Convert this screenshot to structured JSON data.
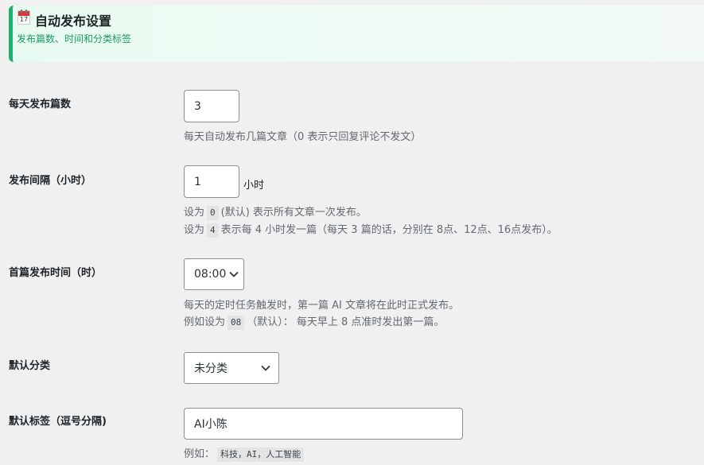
{
  "header": {
    "icon": "calendar-icon",
    "calendar_day": "17",
    "title": "自动发布设置",
    "subtitle": "发布篇数、时间和分类标签"
  },
  "fields": {
    "posts_per_day": {
      "label": "每天发布篇数",
      "value": "3",
      "description": "每天自动发布几篇文章（0 表示只回复评论不发文）"
    },
    "interval": {
      "label": "发布间隔（小时）",
      "value": "1",
      "unit": "小时",
      "desc1_pre": "设为",
      "desc1_code": "0",
      "desc1_post": "(默认) 表示所有文章一次发布。",
      "desc2_pre": "设为",
      "desc2_code": "4",
      "desc2_post": "表示每 4 小时发一篇（每天 3 篇的话，分别在 8点、12点、16点发布）。"
    },
    "first_time": {
      "label": "首篇发布时间（时）",
      "value": "08:00",
      "desc1": "每天的定时任务触发时，第一篇 AI 文章将在此时正式发布。",
      "desc2_pre": "例如设为",
      "desc2_code": "08",
      "desc2_post": "（默认）： 每天早上 8 点准时发出第一篇。"
    },
    "category": {
      "label": "默认分类",
      "value": "未分类"
    },
    "tags": {
      "label": "默认标签（逗号分隔)",
      "value": "AI小陈",
      "desc_pre": "例如：",
      "desc_code": "科技，AI，人工智能"
    }
  }
}
